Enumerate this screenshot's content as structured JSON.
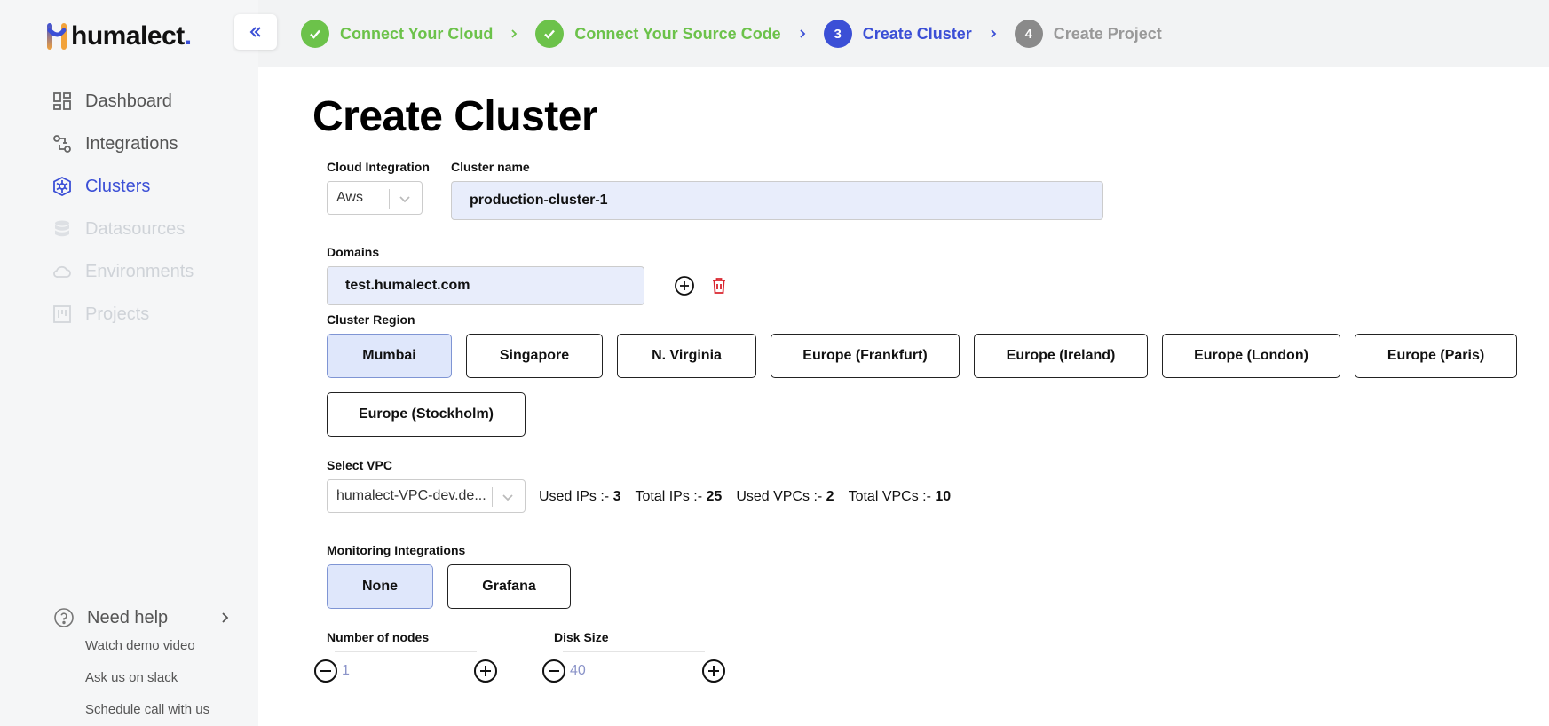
{
  "brand": {
    "name": "humalect",
    "dot": "."
  },
  "nav": {
    "items": [
      {
        "label": "Dashboard",
        "state": "normal"
      },
      {
        "label": "Integrations",
        "state": "normal"
      },
      {
        "label": "Clusters",
        "state": "active"
      },
      {
        "label": "Datasources",
        "state": "disabled"
      },
      {
        "label": "Environments",
        "state": "disabled"
      },
      {
        "label": "Projects",
        "state": "disabled"
      }
    ]
  },
  "help": {
    "title": "Need help",
    "links": [
      "Watch demo video",
      "Ask us on slack",
      "Schedule call with us"
    ]
  },
  "steps": [
    {
      "label": "Connect Your Cloud",
      "status": "done",
      "number": ""
    },
    {
      "label": "Connect Your Source Code",
      "status": "done",
      "number": ""
    },
    {
      "label": "Create Cluster",
      "status": "current",
      "number": "3"
    },
    {
      "label": "Create Project",
      "status": "pending",
      "number": "4"
    }
  ],
  "page": {
    "title": "Create Cluster"
  },
  "form": {
    "cloud_integration": {
      "label": "Cloud Integration",
      "value": "Aws"
    },
    "cluster_name": {
      "label": "Cluster name",
      "value": "production-cluster-1"
    },
    "domains": {
      "label": "Domains",
      "value": "test.humalect.com"
    },
    "region": {
      "label": "Cluster Region",
      "options": [
        "Mumbai",
        "Singapore",
        "N. Virginia",
        "Europe (Frankfurt)",
        "Europe (Ireland)",
        "Europe (London)",
        "Europe (Paris)",
        "Europe (Stockholm)"
      ],
      "selected": "Mumbai"
    },
    "vpc": {
      "label": "Select VPC",
      "value": "humalect-VPC-dev.de...",
      "stats": [
        {
          "label": "Used IPs :- ",
          "value": "3"
        },
        {
          "label": "Total IPs :- ",
          "value": "25"
        },
        {
          "label": "Used VPCs :- ",
          "value": "2"
        },
        {
          "label": "Total VPCs :- ",
          "value": "10"
        }
      ]
    },
    "monitoring": {
      "label": "Monitoring Integrations",
      "options": [
        "None",
        "Grafana"
      ],
      "selected": "None"
    },
    "nodes": {
      "label": "Number of nodes",
      "value": "1"
    },
    "disk": {
      "label": "Disk Size",
      "value": "40"
    }
  },
  "colors": {
    "accent": "#3b4fd6",
    "success": "#6cc24a",
    "danger": "#d9252f",
    "selected_bg": "#dfe7fb",
    "input_bg": "#e8edfb"
  }
}
